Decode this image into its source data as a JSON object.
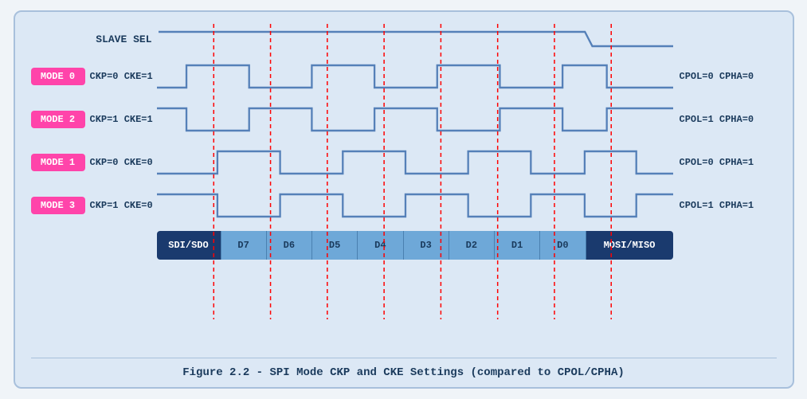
{
  "title": "Figure 2.2 - SPI Mode CKP and CKE Settings (compared to CPOL/CPHA)",
  "slave_label": "SLAVE SEL",
  "modes": [
    {
      "badge": "MODE 0",
      "ckp_cke": "CKP=0 CKE=1",
      "cpol_cpha": "CPOL=0 CPHA=0",
      "type": "mode0"
    },
    {
      "badge": "MODE 2",
      "ckp_cke": "CKP=1 CKE=1",
      "cpol_cpha": "CPOL=1 CPHA=0",
      "type": "mode2"
    },
    {
      "badge": "MODE 1",
      "ckp_cke": "CKP=0 CKE=0",
      "cpol_cpha": "CPOL=0 CPHA=1",
      "type": "mode1"
    },
    {
      "badge": "MODE 3",
      "ckp_cke": "CKP=1 CKE=0",
      "cpol_cpha": "CPOL=1 CPHA=1",
      "type": "mode3"
    }
  ],
  "data_segments": [
    "SDI/SDO",
    "D7",
    "D6",
    "D5",
    "D4",
    "D3",
    "D2",
    "D1",
    "D0",
    "MOSI/MISO"
  ],
  "figure_caption": "Figure 2.2 - SPI Mode CKP and CKE Settings (compared to CPOL/CPHA)",
  "colors": {
    "accent": "#ff44aa",
    "bg": "#dce8f5",
    "border": "#a8c0dc",
    "wave": "#5580b8",
    "dark_blue": "#1a3a6e",
    "text": "#1a3a5c",
    "red_dashes": "#ff0000"
  }
}
